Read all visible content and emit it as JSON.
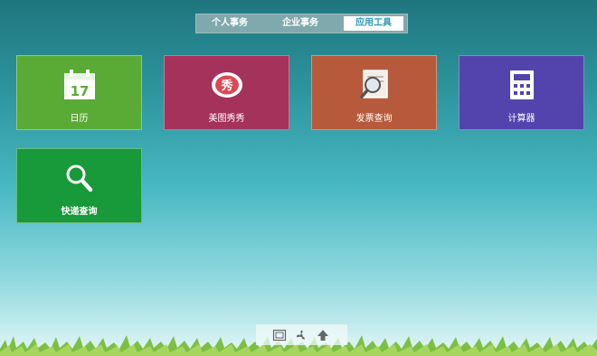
{
  "tabs": [
    {
      "label": "个人事务",
      "active": false
    },
    {
      "label": "企业事务",
      "active": false
    },
    {
      "label": "应用工具",
      "active": true
    }
  ],
  "tiles": [
    {
      "label": "日历",
      "icon": "calendar-icon",
      "icon_text": "17",
      "color": "#5aab36"
    },
    {
      "label": "美图秀秀",
      "icon": "meitu-icon",
      "icon_text": "秀",
      "color": "#a5325a"
    },
    {
      "label": "发票查询",
      "icon": "invoice-search-icon",
      "color": "#b75a3b"
    },
    {
      "label": "计算器",
      "icon": "calculator-icon",
      "color": "#5344ad"
    },
    {
      "label": "快递查询",
      "icon": "magnifier-icon",
      "color": "#18993a"
    }
  ],
  "dock": {
    "icons": [
      "desktop-icon",
      "fan-icon",
      "upload-icon"
    ]
  }
}
